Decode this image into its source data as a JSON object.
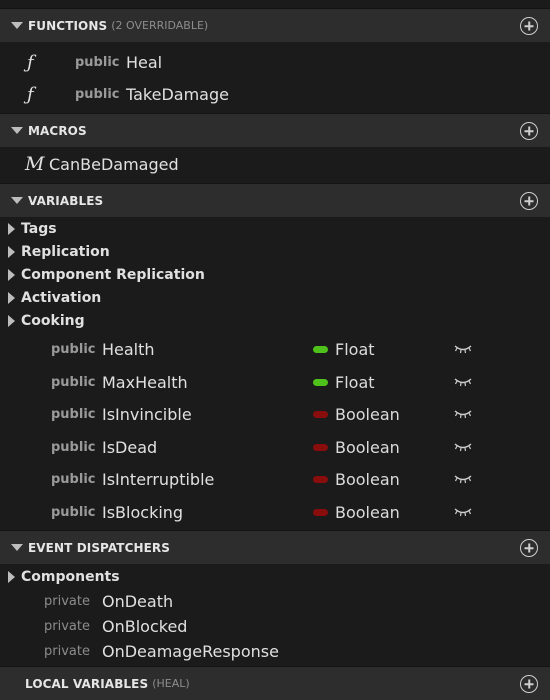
{
  "functions": {
    "title": "FUNCTIONS",
    "subtitle": "(2 OVERRIDABLE)",
    "icon": "function-icon",
    "icon_glyph": "ƒ",
    "items": [
      {
        "access": "public",
        "name": "Heal"
      },
      {
        "access": "public",
        "name": "TakeDamage"
      }
    ]
  },
  "macros": {
    "title": "MACROS",
    "icon": "macro-icon",
    "icon_glyph": "M",
    "items": [
      {
        "name": "CanBeDamaged"
      }
    ]
  },
  "variables": {
    "title": "VARIABLES",
    "categories": [
      "Tags",
      "Replication",
      "Component Replication",
      "Activation",
      "Cooking"
    ],
    "items": [
      {
        "access": "public",
        "name": "Health",
        "type": "Float",
        "type_color": "#4ec21a"
      },
      {
        "access": "public",
        "name": "MaxHealth",
        "type": "Float",
        "type_color": "#4ec21a"
      },
      {
        "access": "public",
        "name": "IsInvincible",
        "type": "Boolean",
        "type_color": "#8a0d0d"
      },
      {
        "access": "public",
        "name": "IsDead",
        "type": "Boolean",
        "type_color": "#8a0d0d"
      },
      {
        "access": "public",
        "name": "IsInterruptible",
        "type": "Boolean",
        "type_color": "#8a0d0d"
      },
      {
        "access": "public",
        "name": "IsBlocking",
        "type": "Boolean",
        "type_color": "#8a0d0d"
      }
    ]
  },
  "event_dispatchers": {
    "title": "EVENT DISPATCHERS",
    "category": "Components",
    "items": [
      {
        "access": "private",
        "name": "OnDeath"
      },
      {
        "access": "private",
        "name": "OnBlocked"
      },
      {
        "access": "private",
        "name": "OnDeamageResponse"
      }
    ]
  },
  "local_variables": {
    "title": "LOCAL VARIABLES",
    "subtitle": "(HEAL)"
  },
  "colors": {
    "background": "#1b1b1b",
    "header": "#2d2d2d",
    "float": "#4ec21a",
    "boolean": "#8a0d0d"
  }
}
